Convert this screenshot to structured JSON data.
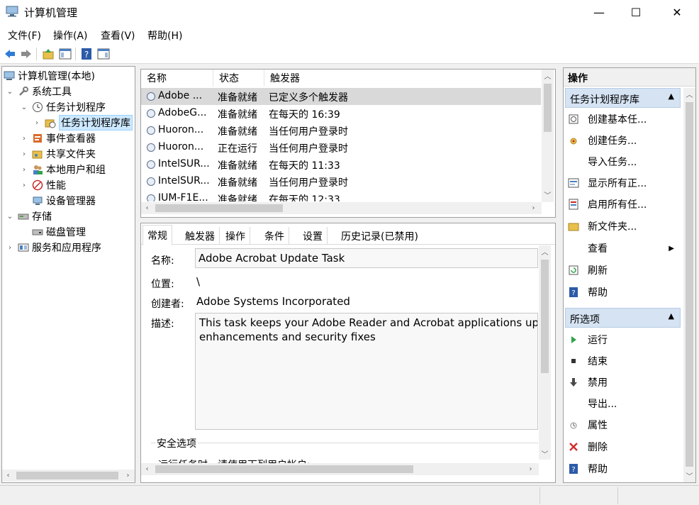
{
  "window": {
    "title": "计算机管理",
    "minimize_icon": "—",
    "maximize_icon": "☐",
    "close_icon": "✕"
  },
  "menu": [
    "文件(F)",
    "操作(A)",
    "查看(V)",
    "帮助(H)"
  ],
  "tree": {
    "root": "计算机管理(本地)",
    "system_tools": "系统工具",
    "task_scheduler": "任务计划程序",
    "task_library": "任务计划程序库",
    "event_viewer": "事件查看器",
    "shared_folders": "共享文件夹",
    "local_users": "本地用户和组",
    "performance": "性能",
    "device_manager": "设备管理器",
    "storage": "存储",
    "disk_management": "磁盘管理",
    "services_apps": "服务和应用程序"
  },
  "task_list": {
    "columns": [
      "名称",
      "状态",
      "触发器"
    ],
    "rows": [
      {
        "name": "Adobe ...",
        "status": "准备就绪",
        "trigger": "已定义多个触发器"
      },
      {
        "name": "AdobeG...",
        "status": "准备就绪",
        "trigger": "在每天的 16:39"
      },
      {
        "name": "Huoron...",
        "status": "准备就绪",
        "trigger": "当任何用户登录时"
      },
      {
        "name": "Huoron...",
        "status": "正在运行",
        "trigger": "当任何用户登录时"
      },
      {
        "name": "IntelSUR...",
        "status": "准备就绪",
        "trigger": "在每天的 11:33"
      },
      {
        "name": "IntelSUR...",
        "status": "准备就绪",
        "trigger": "当任何用户登录时"
      },
      {
        "name": "IUM-F1E...",
        "status": "准备就绪",
        "trigger": "在每天的 12:33"
      }
    ]
  },
  "details": {
    "tabs": [
      "常规",
      "触发器",
      "操作",
      "条件",
      "设置",
      "历史记录(已禁用)"
    ],
    "name_label": "名称:",
    "name_value": "Adobe Acrobat Update Task",
    "location_label": "位置:",
    "location_value": "\\",
    "author_label": "创建者:",
    "author_value": "Adobe Systems Incorporated",
    "desc_label": "描述:",
    "desc_line1": "This task keeps your Adobe Reader and Acrobat applications up to",
    "desc_line2": "enhancements and security fixes",
    "security_label": "安全选项",
    "security_partial": "运行任务时，请使用下列用户帐户:"
  },
  "actions": {
    "header": "操作",
    "section1": "任务计划程序库",
    "section1_items": [
      "创建基本任...",
      "创建任务...",
      "导入任务...",
      "显示所有正...",
      "启用所有任...",
      "新文件夹...",
      "查看",
      "刷新",
      "帮助"
    ],
    "section2": "所选项",
    "section2_items": [
      "运行",
      "结束",
      "禁用",
      "导出...",
      "属性",
      "删除",
      "帮助"
    ]
  }
}
